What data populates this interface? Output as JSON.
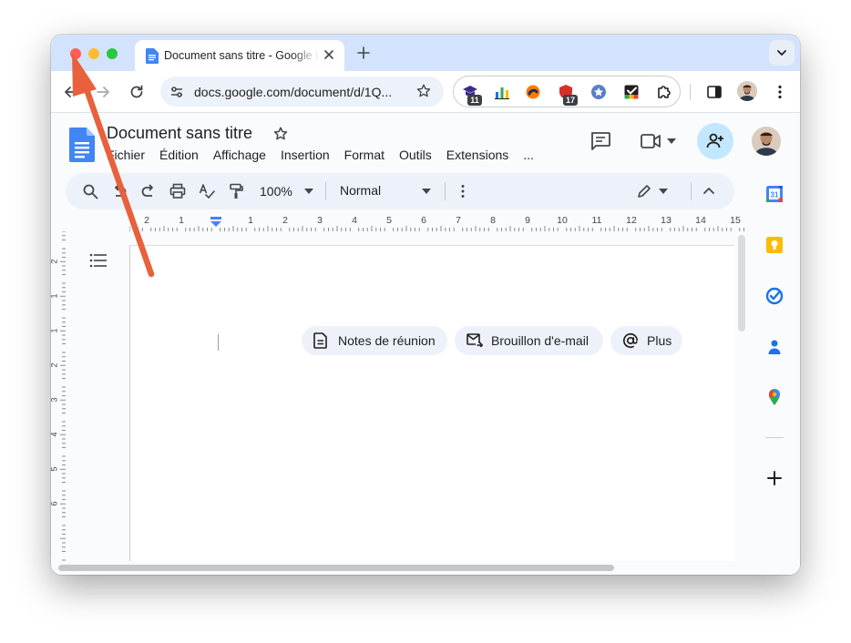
{
  "browser": {
    "tab": {
      "title": "Document sans titre - Google Docs"
    },
    "toolbar": {
      "url": "docs.google.com/document/d/1Q...",
      "extension_badges": [
        "11",
        "17"
      ]
    }
  },
  "docs": {
    "title": "Document sans titre",
    "menu": [
      "Fichier",
      "Édition",
      "Affichage",
      "Insertion",
      "Format",
      "Outils",
      "Extensions",
      "..."
    ],
    "format_toolbar": {
      "zoom": "100%",
      "style": "Normal"
    },
    "chips": [
      {
        "label": "Notes de réunion",
        "icon": "document-icon"
      },
      {
        "label": "Brouillon d'e-mail",
        "icon": "email-draft-icon"
      },
      {
        "label": "Plus",
        "icon": "at-sign-icon"
      }
    ],
    "ruler_numbers": [
      "2",
      "1",
      "1",
      "2",
      "3",
      "4",
      "5",
      "6",
      "7",
      "8",
      "9",
      "10",
      "11",
      "12",
      "13",
      "14",
      "15"
    ],
    "vertical_ruler_numbers": [
      "2",
      "1",
      "1",
      "2",
      "3",
      "4",
      "5",
      "6"
    ]
  },
  "colors": {
    "tabstrip": "#d3e3fd",
    "docs_blue": "#4285f4",
    "share_button": "#c2e7ff",
    "annotation_arrow": "#e8603c"
  }
}
